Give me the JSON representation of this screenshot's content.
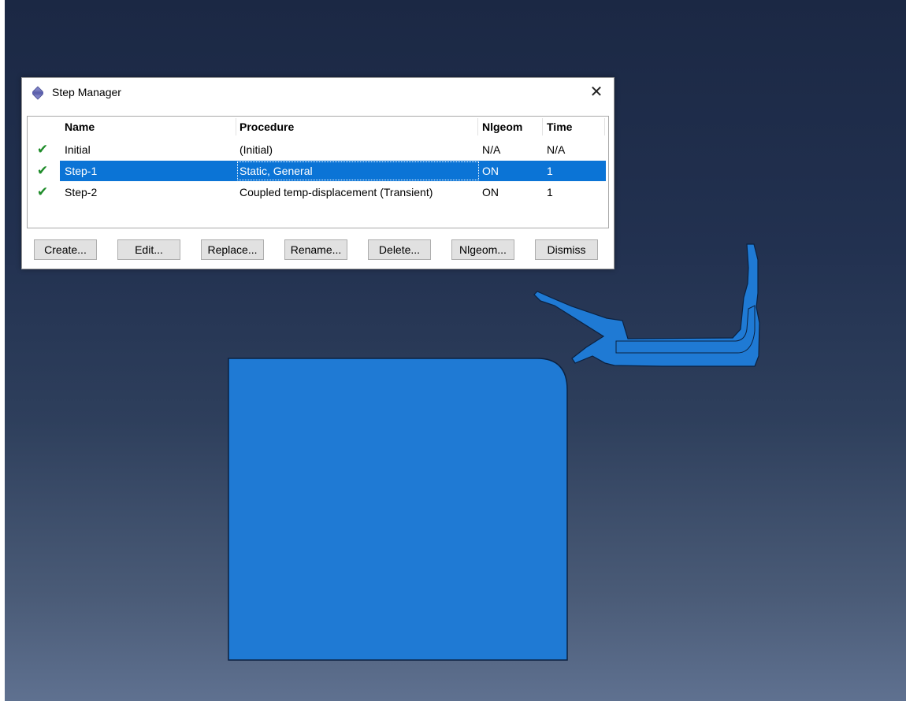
{
  "dialog": {
    "title": "Step Manager",
    "close_glyph": "✕",
    "title_icon": "step-manager-icon"
  },
  "table": {
    "headers": {
      "name": "Name",
      "procedure": "Procedure",
      "nlgeom": "Nlgeom",
      "time": "Time"
    },
    "rows": [
      {
        "status": "✔",
        "name": "Initial",
        "procedure": "(Initial)",
        "nlgeom": "N/A",
        "time": "N/A",
        "selected": false
      },
      {
        "status": "✔",
        "name": "Step-1",
        "procedure": "Static, General",
        "nlgeom": "ON",
        "time": "1",
        "selected": true
      },
      {
        "status": "✔",
        "name": "Step-2",
        "procedure": "Coupled temp-displacement (Transient)",
        "nlgeom": "ON",
        "time": "1",
        "selected": false
      }
    ]
  },
  "buttons": {
    "create": "Create...",
    "edit": "Edit...",
    "replace": "Replace...",
    "rename": "Rename...",
    "delete": "Delete...",
    "nlgeom": "Nlgeom...",
    "dismiss": "Dismiss"
  },
  "colors": {
    "selection": "#0b74d6",
    "check_mark": "#1f8c2a",
    "model_fill": "#1f7ad4",
    "model_edge": "#0b2140",
    "viewport_top": "#1b2844",
    "viewport_bottom": "#5f7190"
  }
}
